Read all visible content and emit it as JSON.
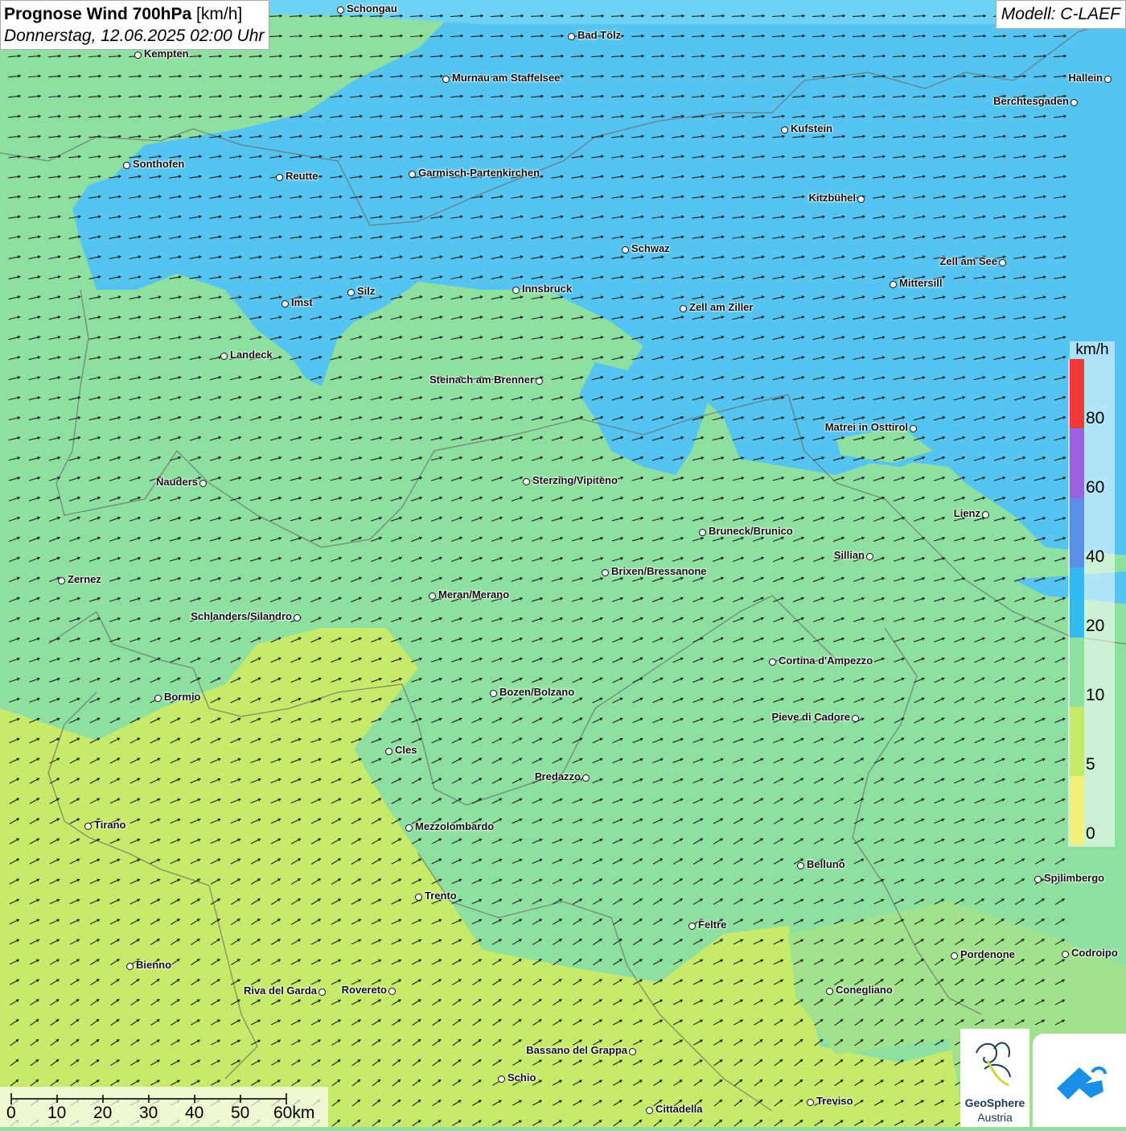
{
  "title": {
    "main_bold": "Prognose Wind 700hPa",
    "main_unit": " [km/h]",
    "date": "Donnerstag, 12.06.2025 02:00 Uhr"
  },
  "model": "Modell: C-LAEF",
  "legend": {
    "unit": "km/h",
    "labels": [
      "80",
      "60",
      "40",
      "20",
      "10",
      "5",
      "0"
    ],
    "colors": [
      "#f03a3a",
      "#9a62e0",
      "#5b8ee8",
      "#34b9ee",
      "#8ee0a0",
      "#c6ea6a",
      "#f0f07a"
    ]
  },
  "scale": {
    "labels": [
      "0",
      "10",
      "20",
      "30",
      "40",
      "50",
      "60km"
    ]
  },
  "logo": {
    "line1": "GeoSphere",
    "line2": "Austria"
  },
  "cities": [
    {
      "name": "Schongau"
    },
    {
      "name": "Bad Tölz"
    },
    {
      "name": "Kempten"
    },
    {
      "name": "Murnau am Staffelsee"
    },
    {
      "name": "Hallein"
    },
    {
      "name": "Berchtesgaden"
    },
    {
      "name": "Kufstein"
    },
    {
      "name": "Sonthofen"
    },
    {
      "name": "Reutte"
    },
    {
      "name": "Garmisch-Partenkirchen"
    },
    {
      "name": "Kitzbühel"
    },
    {
      "name": "Schwaz"
    },
    {
      "name": "Zell am See"
    },
    {
      "name": "Mittersill"
    },
    {
      "name": "Imst"
    },
    {
      "name": "Silz"
    },
    {
      "name": "Innsbruck"
    },
    {
      "name": "Zell am Ziller"
    },
    {
      "name": "Landeck"
    },
    {
      "name": "Steinach am Brenner"
    },
    {
      "name": "Matrei in Osttirol"
    },
    {
      "name": "Nauders"
    },
    {
      "name": "Sterzing/Vipiteno"
    },
    {
      "name": "Lienz"
    },
    {
      "name": "Bruneck/Brunico"
    },
    {
      "name": "Sillian"
    },
    {
      "name": "Zernez"
    },
    {
      "name": "Brixen/Bressanone"
    },
    {
      "name": "Meran/Merano"
    },
    {
      "name": "Schlanders/Silandro"
    },
    {
      "name": "Cortina d'Ampezzo"
    },
    {
      "name": "Bozen/Bolzano"
    },
    {
      "name": "Bormio"
    },
    {
      "name": "Pieve di Cadore"
    },
    {
      "name": "Cles"
    },
    {
      "name": "Predazzo"
    },
    {
      "name": "Tirano"
    },
    {
      "name": "Mezzolombardo"
    },
    {
      "name": "Belluno"
    },
    {
      "name": "Spilimbergo"
    },
    {
      "name": "Trento"
    },
    {
      "name": "Feltre"
    },
    {
      "name": "Bienno"
    },
    {
      "name": "Pordenone"
    },
    {
      "name": "Codroipo"
    },
    {
      "name": "Riva del Garda"
    },
    {
      "name": "Rovereto"
    },
    {
      "name": "Conegliano"
    },
    {
      "name": "Bassano del Grappa"
    },
    {
      "name": "Schio"
    },
    {
      "name": "Treviso"
    },
    {
      "name": "Cittadella"
    }
  ]
}
